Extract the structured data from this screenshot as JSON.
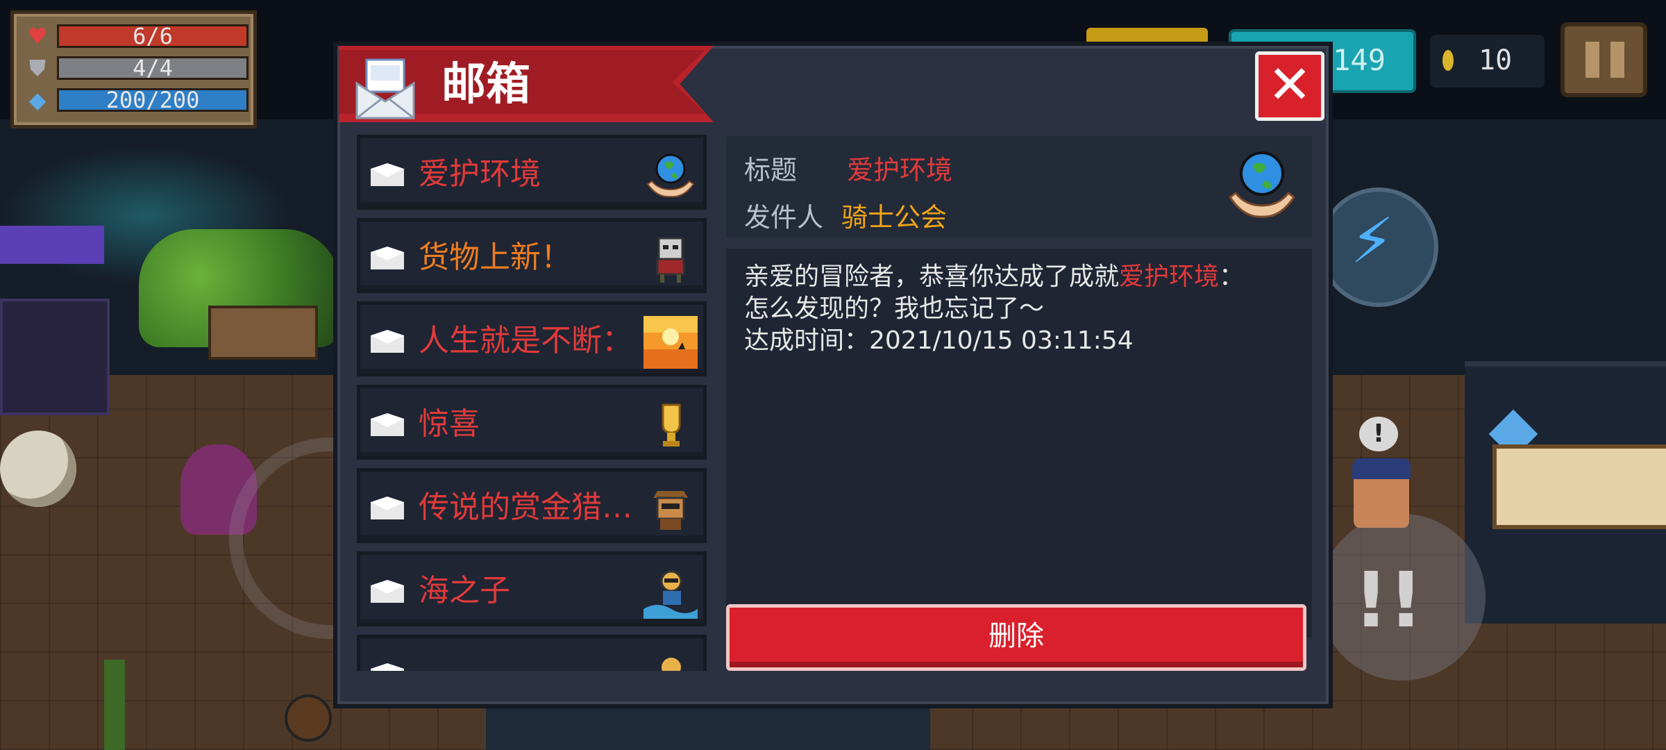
{
  "hud": {
    "hp": "6/6",
    "armor": "4/4",
    "energy": "200/200",
    "gems": "149",
    "coins": "10",
    "icons": {
      "hp": "heart-icon",
      "armor": "shield-icon",
      "energy": "energy-diamond-icon",
      "coin": "coin-icon",
      "pause": "pause-icon"
    }
  },
  "mailbox": {
    "title": "邮箱",
    "close_label": "✕",
    "items": [
      {
        "label": "爱护环境",
        "color": "red",
        "thumb": "earth-in-hands-icon"
      },
      {
        "label": "货物上新！",
        "color": "orange",
        "thumb": "merchant-icon"
      },
      {
        "label": "人生就是不断：",
        "color": "red",
        "thumb": "sunset-desert-icon"
      },
      {
        "label": "惊喜",
        "color": "red",
        "thumb": "golden-cup-icon"
      },
      {
        "label": "传说的赏金猎…",
        "color": "red",
        "thumb": "bounty-hunter-icon"
      },
      {
        "label": "海之子",
        "color": "red",
        "thumb": "sea-child-icon"
      },
      {
        "label": "",
        "color": "red",
        "thumb": "partial-item-icon"
      }
    ],
    "detail": {
      "title_label": "标题",
      "title_value": "爱护环境",
      "sender_label": "发件人",
      "sender_value": "骑士公会",
      "body_prefix": "亲爱的冒险者，恭喜你达成了成就",
      "body_achievement": "爱护环境",
      "body_suffix": "：",
      "body_line2": "怎么发现的？我也忘记了～",
      "body_line3": "达成时间：2021/10/15 03:11:54",
      "header_icon": "earth-in-hands-icon"
    },
    "delete_label": "删除"
  },
  "colors": {
    "accent_red": "#d9202c",
    "mail_red_text": "#e13a3a",
    "mail_orange_text": "#ef7d1f",
    "sender_gold": "#f0a417"
  }
}
